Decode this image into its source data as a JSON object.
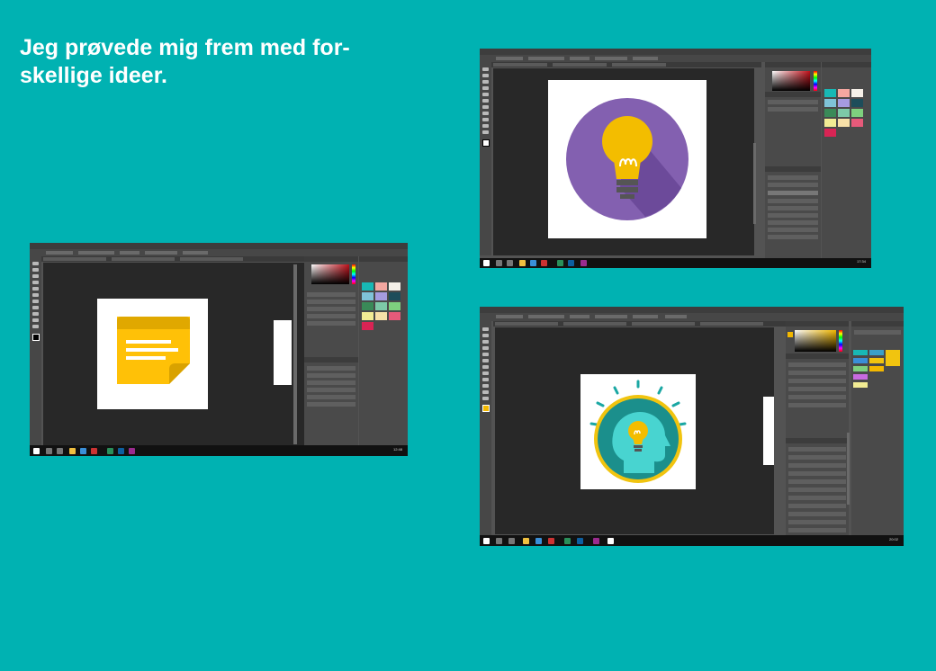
{
  "heading": {
    "line1": "Jeg prøvede mig frem med for-",
    "line2": "skellige ideer."
  },
  "screenshots": [
    {
      "subject": "sticky-note",
      "app": "Photoshop",
      "clock": "12:48"
    },
    {
      "subject": "lightbulb-circle",
      "app": "Photoshop",
      "clock": "17:34"
    },
    {
      "subject": "head-lightbulb-badge",
      "app": "Photoshop",
      "clock": "20:02"
    }
  ],
  "colors": {
    "background": "#00b2b2",
    "heading_text": "#ffffff",
    "sticky_note": "#ffc107",
    "sticky_note_top": "#e0a800",
    "bulb_circle": "#8360b0",
    "bulb": "#f3bd00",
    "badge_ring": "#f1c40f",
    "badge_teal": "#1aa7a3",
    "head": "#48d4d0"
  }
}
